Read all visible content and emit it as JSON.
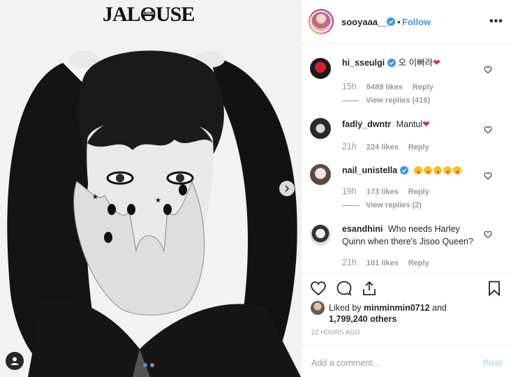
{
  "post": {
    "magazine_logo": "JALOUSE",
    "magazine_logo_sub": "CHINA",
    "carousel_total": 2,
    "carousel_active": 1
  },
  "header": {
    "username": "sooyaaa__",
    "dot": "•",
    "follow_label": "Follow",
    "more_label": "•••"
  },
  "comments": [
    {
      "user": "hi_sseulgi",
      "verified": true,
      "text": "오 이뻐라",
      "emoji": "heart",
      "time": "15h",
      "likes": "8489 likes",
      "reply": "Reply",
      "replies": "View replies (416)"
    },
    {
      "user": "fadly_dwntr",
      "verified": false,
      "text": "Mantul",
      "emoji": "heart",
      "time": "21h",
      "likes": "224 likes",
      "reply": "Reply"
    },
    {
      "user": "nail_unistella",
      "verified": true,
      "text": "",
      "emoji": "faces",
      "time": "19h",
      "likes": "173 likes",
      "reply": "Reply",
      "replies": "View replies (2)"
    },
    {
      "user": "esandhini",
      "verified": false,
      "text": "Who needs Harley Quinn when there's Jisoo Queen?",
      "time": "21h",
      "likes": "101 likes",
      "reply": "Reply"
    }
  ],
  "likes": {
    "prefix": "Liked by",
    "user": "minminmin0712",
    "and": "and",
    "count": "1,799,240 others"
  },
  "timestamp": "22 HOURS AGO",
  "add_comment": {
    "placeholder": "Add a comment…",
    "post_label": "Post"
  },
  "colors": {
    "link_blue": "#3897f0",
    "post_disabled": "#b2dffc",
    "heart": "#e0245e",
    "muted": "#999999"
  }
}
